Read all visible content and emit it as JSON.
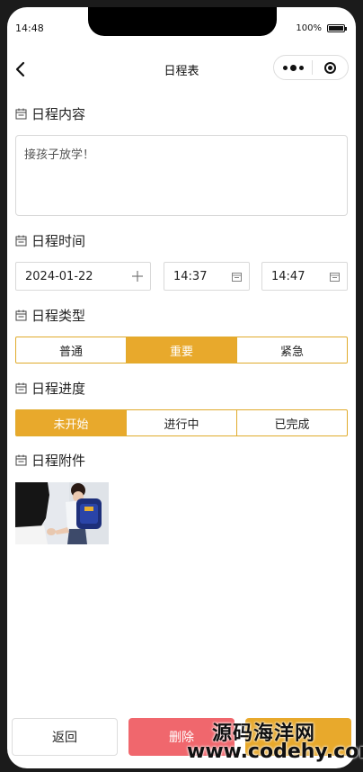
{
  "status_bar": {
    "time": "14:48",
    "battery": "100%"
  },
  "navbar": {
    "title": "日程表",
    "back_icon": "chevron-left-icon",
    "more_icon": "more-dots-icon",
    "target_icon": "target-circle-icon"
  },
  "sections": {
    "content_title": "日程内容",
    "time_title": "日程时间",
    "type_title": "日程类型",
    "progress_title": "日程进度",
    "attachment_title": "日程附件"
  },
  "schedule": {
    "content_value": "接孩子放学！",
    "date": "2024-01-22",
    "start_time": "14:37",
    "end_time": "14:47"
  },
  "type_options": [
    "普通",
    "重要",
    "紧急"
  ],
  "type_selected": "重要",
  "progress_options": [
    "未开始",
    "进行中",
    "已完成"
  ],
  "progress_selected": "未开始",
  "buttons": {
    "back": "返回",
    "delete": "删除"
  },
  "watermark": {
    "line1": "源码海洋网",
    "line2": "www.codehy.com"
  },
  "colors": {
    "accent": "#e8a92c",
    "delete": "#f0676d"
  }
}
